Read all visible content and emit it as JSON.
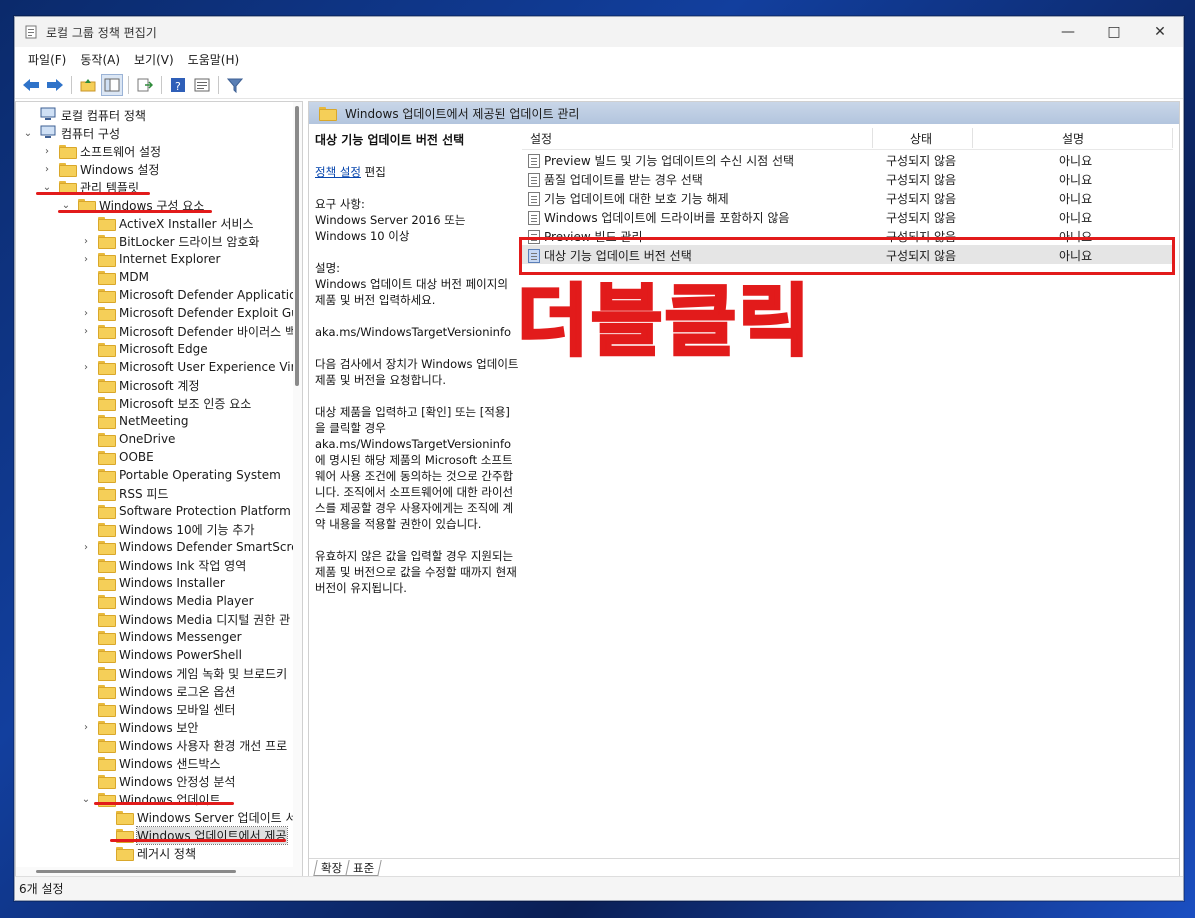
{
  "window": {
    "title": "로컬 그룹 정책 편집기"
  },
  "menu": [
    "파일(F)",
    "동작(A)",
    "보기(V)",
    "도움말(H)"
  ],
  "tree": [
    {
      "label": "로컬 컴퓨터 정책",
      "level": 0,
      "chevron": "",
      "icon": "computer"
    },
    {
      "label": "컴퓨터 구성",
      "level": 0,
      "chevron": "⌄",
      "icon": "computer"
    },
    {
      "label": "소프트웨어 설정",
      "level": 1,
      "chevron": "›",
      "icon": "folder"
    },
    {
      "label": "Windows 설정",
      "level": 1,
      "chevron": "›",
      "icon": "folder"
    },
    {
      "label": "관리 템플릿",
      "level": 1,
      "chevron": "⌄",
      "icon": "folder"
    },
    {
      "label": "Windows 구성 요소",
      "level": 2,
      "chevron": "⌄",
      "icon": "folder"
    },
    {
      "label": "ActiveX Installer 서비스",
      "level": 3,
      "chevron": "",
      "icon": "folder"
    },
    {
      "label": "BitLocker 드라이브 암호화",
      "level": 3,
      "chevron": "›",
      "icon": "folder"
    },
    {
      "label": "Internet Explorer",
      "level": 3,
      "chevron": "›",
      "icon": "folder"
    },
    {
      "label": "MDM",
      "level": 3,
      "chevron": "",
      "icon": "folder"
    },
    {
      "label": "Microsoft Defender Application",
      "level": 3,
      "chevron": "",
      "icon": "folder"
    },
    {
      "label": "Microsoft Defender Exploit Gua",
      "level": 3,
      "chevron": "›",
      "icon": "folder"
    },
    {
      "label": "Microsoft Defender 바이러스 백",
      "level": 3,
      "chevron": "›",
      "icon": "folder"
    },
    {
      "label": "Microsoft Edge",
      "level": 3,
      "chevron": "",
      "icon": "folder"
    },
    {
      "label": "Microsoft User Experience Virtu",
      "level": 3,
      "chevron": "›",
      "icon": "folder"
    },
    {
      "label": "Microsoft 계정",
      "level": 3,
      "chevron": "",
      "icon": "folder"
    },
    {
      "label": "Microsoft 보조 인증 요소",
      "level": 3,
      "chevron": "",
      "icon": "folder"
    },
    {
      "label": "NetMeeting",
      "level": 3,
      "chevron": "",
      "icon": "folder"
    },
    {
      "label": "OneDrive",
      "level": 3,
      "chevron": "",
      "icon": "folder"
    },
    {
      "label": "OOBE",
      "level": 3,
      "chevron": "",
      "icon": "folder"
    },
    {
      "label": "Portable Operating System",
      "level": 3,
      "chevron": "",
      "icon": "folder"
    },
    {
      "label": "RSS 피드",
      "level": 3,
      "chevron": "",
      "icon": "folder"
    },
    {
      "label": "Software Protection Platform",
      "level": 3,
      "chevron": "",
      "icon": "folder"
    },
    {
      "label": "Windows 10에 기능 추가",
      "level": 3,
      "chevron": "",
      "icon": "folder"
    },
    {
      "label": "Windows Defender SmartScreen",
      "level": 3,
      "chevron": "›",
      "icon": "folder"
    },
    {
      "label": "Windows Ink 작업 영역",
      "level": 3,
      "chevron": "",
      "icon": "folder"
    },
    {
      "label": "Windows Installer",
      "level": 3,
      "chevron": "",
      "icon": "folder"
    },
    {
      "label": "Windows Media Player",
      "level": 3,
      "chevron": "",
      "icon": "folder"
    },
    {
      "label": "Windows Media 디지털 권한 관",
      "level": 3,
      "chevron": "",
      "icon": "folder"
    },
    {
      "label": "Windows Messenger",
      "level": 3,
      "chevron": "",
      "icon": "folder"
    },
    {
      "label": "Windows PowerShell",
      "level": 3,
      "chevron": "",
      "icon": "folder"
    },
    {
      "label": "Windows 게임 녹화 및 브로드키",
      "level": 3,
      "chevron": "",
      "icon": "folder"
    },
    {
      "label": "Windows 로그온 옵션",
      "level": 3,
      "chevron": "",
      "icon": "folder"
    },
    {
      "label": "Windows 모바일 센터",
      "level": 3,
      "chevron": "",
      "icon": "folder"
    },
    {
      "label": "Windows 보안",
      "level": 3,
      "chevron": "›",
      "icon": "folder"
    },
    {
      "label": "Windows 사용자 환경 개선 프로",
      "level": 3,
      "chevron": "",
      "icon": "folder"
    },
    {
      "label": "Windows 샌드박스",
      "level": 3,
      "chevron": "",
      "icon": "folder"
    },
    {
      "label": "Windows 안정성 분석",
      "level": 3,
      "chevron": "",
      "icon": "folder"
    },
    {
      "label": "Windows 업데이트",
      "level": 3,
      "chevron": "⌄",
      "icon": "folder"
    },
    {
      "label": "Windows Server 업데이트 서",
      "level": 4,
      "chevron": "",
      "icon": "folder"
    },
    {
      "label": "Windows 업데이트에서 제공",
      "level": 4,
      "chevron": "",
      "icon": "folder",
      "selected": true
    },
    {
      "label": "레거시 정책",
      "level": 4,
      "chevron": "",
      "icon": "folder"
    }
  ],
  "right_header": "Windows 업데이트에서 제공된 업데이트 관리",
  "description": {
    "heading": "대상 기능 업데이트 버전 선택",
    "link": "정책 설정",
    "link_suffix": " 편집",
    "requirements": "요구 사항:\nWindows Server 2016 또는\nWindows 10 이상",
    "desc_label": "설명:",
    "desc1": "Windows 업데이트 대상 버전 페이지의 제품 및 버전 입력하세요.",
    "desc2": "aka.ms/WindowsTargetVersioninfo",
    "desc3": "다음 검사에서 장치가 Windows 업데이트 제품 및 버전을 요청합니다.",
    "desc4": "대상 제품을 입력하고 [확인] 또는 [적용]을 클릭할 경우 aka.ms/WindowsTargetVersioninfo에 명시된 해당 제품의 Microsoft 소프트웨어 사용 조건에 동의하는 것으로 간주합니다. 조직에서 소프트웨어에 대한 라이선스를 제공할 경우 사용자에게는 조직에 계약 내용을 적용할 권한이 있습니다.",
    "desc5": "유효하지 않은 값을 입력할 경우 지원되는 제품 및 버전으로 값을 수정할 때까지 현재 버전이 유지됩니다."
  },
  "list": {
    "headers": {
      "setting": "설정",
      "state": "상태",
      "note": "설명"
    },
    "rows": [
      {
        "name": "Preview 빌드 및 기능 업데이트의 수신 시점 선택",
        "state": "구성되지 않음",
        "note": "아니요"
      },
      {
        "name": "품질 업데이트를 받는 경우 선택",
        "state": "구성되지 않음",
        "note": "아니요"
      },
      {
        "name": "기능 업데이트에 대한 보호 기능 해제",
        "state": "구성되지 않음",
        "note": "아니요"
      },
      {
        "name": "Windows 업데이트에 드라이버를 포함하지 않음",
        "state": "구성되지 않음",
        "note": "아니요"
      },
      {
        "name": "Preview 빌드 관리",
        "state": "구성되지 않음",
        "note": "아니요"
      },
      {
        "name": "대상 기능 업데이트 버전 선택",
        "state": "구성되지 않음",
        "note": "아니요",
        "selected": true
      }
    ]
  },
  "annotation": "더블클릭",
  "tabs": [
    "확장",
    "표준"
  ],
  "status": "6개 설정",
  "colors": {
    "annotation_red": "#e21b1b",
    "header_blue": "#b3c5de"
  }
}
